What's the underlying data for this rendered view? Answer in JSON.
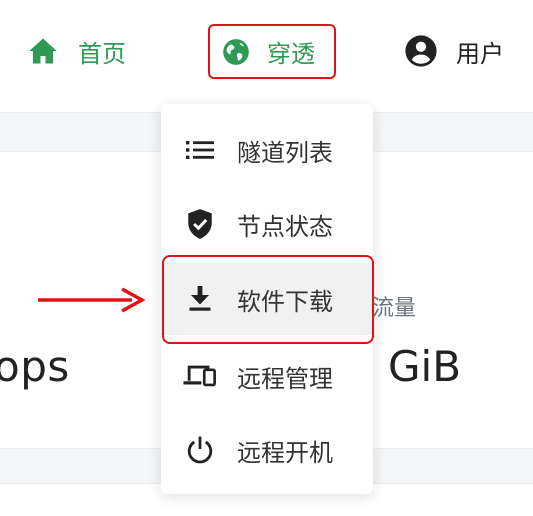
{
  "nav": {
    "home_label": "首页",
    "tunnel_label": "穿透",
    "user_label": "用户"
  },
  "background": {
    "stat_left_value": "ops",
    "stat_right_label": "流量",
    "stat_right_value": "GiB"
  },
  "dropdown": {
    "items": [
      {
        "label": "隧道列表",
        "icon": "list-icon"
      },
      {
        "label": "节点状态",
        "icon": "shield-check-icon"
      },
      {
        "label": "软件下载",
        "icon": "download-icon",
        "highlighted": true
      },
      {
        "label": "远程管理",
        "icon": "devices-icon"
      },
      {
        "label": "远程开机",
        "icon": "power-icon"
      }
    ]
  },
  "colors": {
    "accent_green": "#2e9a54",
    "annotation_red": "#e01414",
    "text_dark": "#222222",
    "muted_gray": "#6c757d"
  }
}
